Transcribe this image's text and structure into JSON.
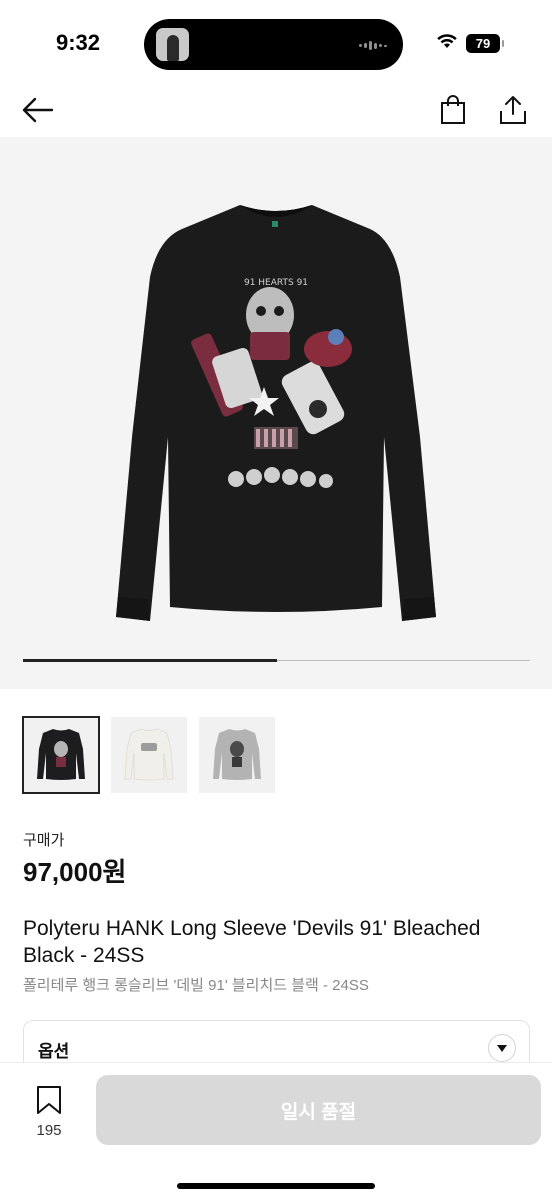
{
  "status_bar": {
    "time": "9:32",
    "battery": "79",
    "icons": [
      "wifi-icon",
      "battery-icon"
    ]
  },
  "nav": {
    "icons": [
      "back-arrow-icon",
      "shopping-bag-icon",
      "share-icon"
    ]
  },
  "gallery": {
    "progress": 0.5,
    "thumbnails": [
      {
        "name": "thumbnail-black",
        "color": "#1d1d1f",
        "selected": true
      },
      {
        "name": "thumbnail-white",
        "color": "#f1efe9",
        "selected": false
      },
      {
        "name": "thumbnail-gray",
        "color": "#b3b3b3",
        "selected": false
      }
    ]
  },
  "price": {
    "label": "구매가",
    "value": "97,000원"
  },
  "product": {
    "title_en": "Polyteru HANK Long Sleeve 'Devils 91' Bleached Black - 24SS",
    "title_ko": "폴리테루 행크 롱슬리브 '데빌 91' 블리치드 블랙 - 24SS",
    "graphic_text": "91 HEARTS 91"
  },
  "option": {
    "label": "옵션",
    "icon": "chevron-down-icon"
  },
  "bottom_bar": {
    "wish_count": "195",
    "buy_label": "일시 품절",
    "icon": "bookmark-icon"
  },
  "colors": {
    "button_disabled": "#d9d9d9",
    "subtitle_gray": "#888888"
  }
}
